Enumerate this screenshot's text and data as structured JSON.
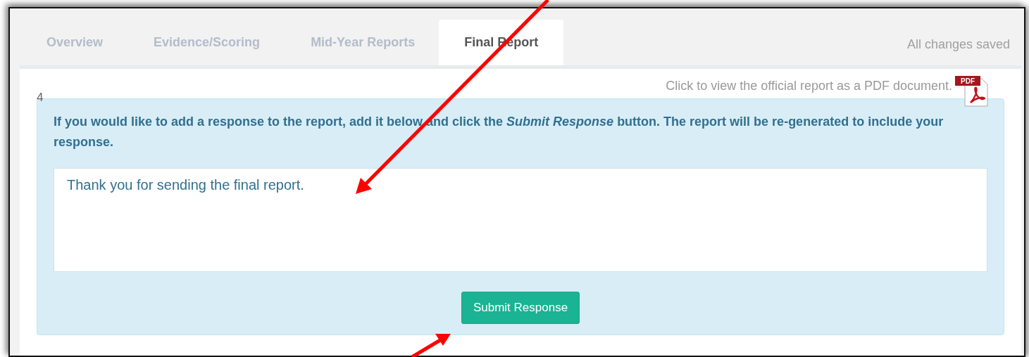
{
  "tabs": [
    {
      "label": "Overview",
      "selected": false
    },
    {
      "label": "Evidence/Scoring",
      "selected": false
    },
    {
      "label": "Mid-Year Reports",
      "selected": false
    },
    {
      "label": "Final Report",
      "selected": true
    }
  ],
  "save_status": "All changes saved",
  "pdf_link": "Click to view the official report as a PDF document.",
  "pdf_icon_label": "PDF",
  "item_number": "4",
  "instructions": "If you would like to add a response to the report, add it below and click the *Submit Response* button. The report will be re-generated to include your response.",
  "response": {
    "value": "Thank you for sending the final report."
  },
  "submit_button": "Submit Response"
}
